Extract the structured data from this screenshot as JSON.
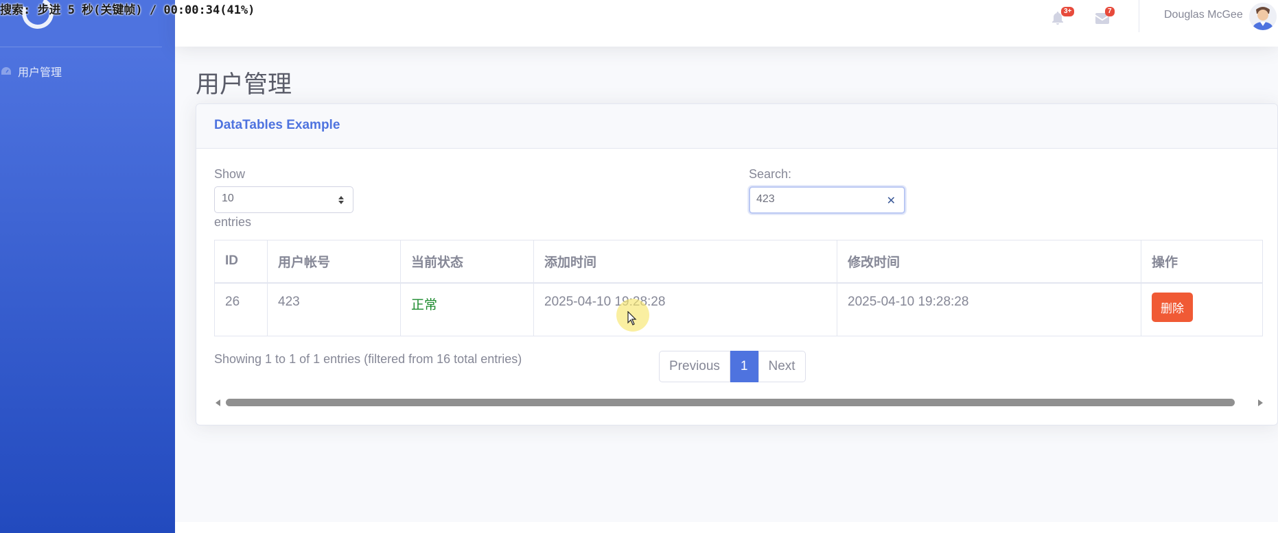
{
  "overlay": {
    "text": "搜索: 步进 5 秒(关键帧) / 00:00:34(41%)"
  },
  "sidebar": {
    "items": [
      {
        "label": "用户管理",
        "icon": "dashboard-icon"
      }
    ]
  },
  "topbar": {
    "alerts_badge": "3+",
    "messages_badge": "7",
    "user_name": "Douglas McGee"
  },
  "page": {
    "title": "用户管理"
  },
  "card": {
    "title": "DataTables Example",
    "length": {
      "label_before": "Show",
      "value": "10",
      "label_after": "entries"
    },
    "search": {
      "label": "Search:",
      "value": "423"
    },
    "table": {
      "columns": [
        "ID",
        "用户帐号",
        "当前状态",
        "添加时间",
        "修改时间",
        "操作"
      ],
      "rows": [
        {
          "id": "26",
          "account": "423",
          "status": "正常",
          "created": "2025-04-10 19:28:28",
          "modified": "2025-04-10 19:28:28",
          "action": "删除"
        }
      ]
    },
    "info": "Showing 1 to 1 of 1 entries (filtered from 16 total entries)",
    "pagination": {
      "previous": "Previous",
      "current": "1",
      "next": "Next"
    }
  },
  "colors": {
    "primary": "#4e73df",
    "danger": "#f05a35",
    "status_ok": "#1b8a2d",
    "badge": "#e74a3b"
  }
}
